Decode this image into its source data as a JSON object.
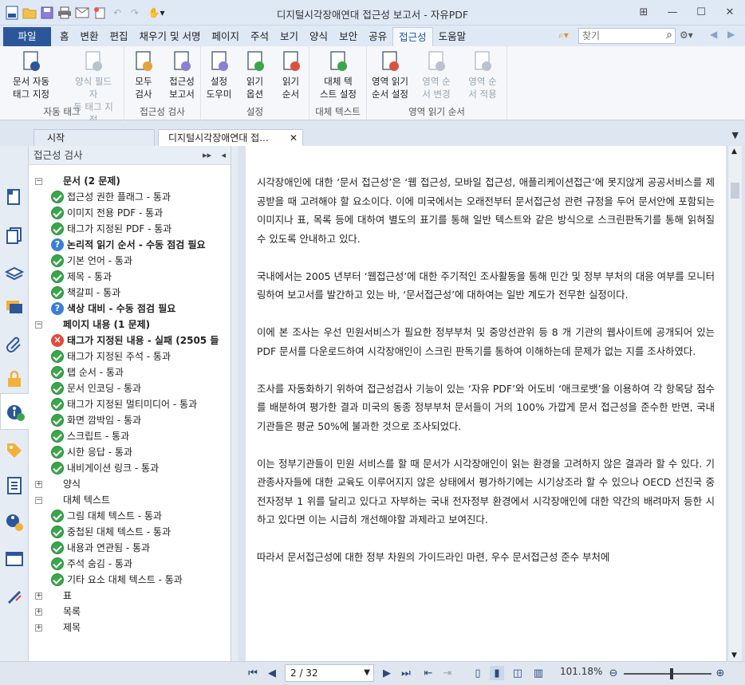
{
  "app": {
    "title": "디지털시각장애연대 접근성 보고서 - 자유PDF"
  },
  "ribbon_tabs": {
    "file": "파일",
    "items": [
      "홈",
      "변환",
      "편집",
      "채우기 및 서명",
      "페이지",
      "주석",
      "보기",
      "양식",
      "보안",
      "공유",
      "접근성",
      "도움말"
    ],
    "active_index": 10
  },
  "search": {
    "placeholder": "찾기"
  },
  "ribbon": {
    "groups": [
      {
        "label": "자동 태그",
        "buttons": [
          {
            "l1": "문서 자동",
            "l2": "태그 지정",
            "disabled": false
          },
          {
            "l1": "양식 필드 자",
            "l2": "동 태그 지정",
            "disabled": true
          }
        ]
      },
      {
        "label": "접근성 검사",
        "buttons": [
          {
            "l1": "모두",
            "l2": "검사",
            "disabled": false
          },
          {
            "l1": "접근성",
            "l2": "보고서",
            "disabled": false
          }
        ]
      },
      {
        "label": "설정",
        "buttons": [
          {
            "l1": "설정",
            "l2": "도우미",
            "disabled": false
          },
          {
            "l1": "읽기",
            "l2": "옵션",
            "disabled": false
          },
          {
            "l1": "읽기",
            "l2": "순서",
            "disabled": false
          }
        ]
      },
      {
        "label": "대체 텍스트",
        "buttons": [
          {
            "l1": "대체 텍",
            "l2": "스트 설정",
            "disabled": false
          }
        ]
      },
      {
        "label": "영역 읽기 순서",
        "buttons": [
          {
            "l1": "영역 읽기",
            "l2": "순서 설정",
            "disabled": false
          },
          {
            "l1": "영역 순",
            "l2": "서 변경",
            "disabled": true
          },
          {
            "l1": "영역 순",
            "l2": "서 적용",
            "disabled": true
          }
        ]
      }
    ]
  },
  "doc_tabs": {
    "start": "시작",
    "document": "디지털시각장애연대 접..."
  },
  "panel": {
    "title": "접근성 검사"
  },
  "tree": [
    {
      "level": 0,
      "exp": "-",
      "status": "",
      "text": "문서 (2 문제)",
      "bold": true
    },
    {
      "level": 1,
      "exp": "",
      "status": "pass",
      "text": "접근성 권한 플래그 - 통과",
      "bold": false
    },
    {
      "level": 1,
      "exp": "",
      "status": "pass",
      "text": "이미지 전용 PDF - 통과",
      "bold": false
    },
    {
      "level": 1,
      "exp": "",
      "status": "pass",
      "text": "태그가 지정된 PDF - 통과",
      "bold": false
    },
    {
      "level": 1,
      "exp": "",
      "status": "q",
      "text": "논리적 읽기 순서 - 수동 점검 필요",
      "bold": true
    },
    {
      "level": 1,
      "exp": "",
      "status": "pass",
      "text": "기본 언어 - 통과",
      "bold": false
    },
    {
      "level": 1,
      "exp": "",
      "status": "pass",
      "text": "제목 - 통과",
      "bold": false
    },
    {
      "level": 1,
      "exp": "",
      "status": "pass",
      "text": "책갈피 - 통과",
      "bold": false
    },
    {
      "level": 1,
      "exp": "",
      "status": "q",
      "text": "색상 대비 - 수동 점검 필요",
      "bold": true
    },
    {
      "level": 0,
      "exp": "-",
      "status": "",
      "text": "페이지 내용 (1 문제)",
      "bold": true
    },
    {
      "level": 1,
      "exp": "",
      "status": "fail",
      "text": "태그가 지정된 내용 - 실패 (2505 들",
      "bold": true
    },
    {
      "level": 1,
      "exp": "",
      "status": "pass",
      "text": "태그가 지정된 주석 - 통과",
      "bold": false
    },
    {
      "level": 1,
      "exp": "",
      "status": "pass",
      "text": "탭 순서 - 통과",
      "bold": false
    },
    {
      "level": 1,
      "exp": "",
      "status": "pass",
      "text": "문서 인코딩 - 통과",
      "bold": false
    },
    {
      "level": 1,
      "exp": "",
      "status": "pass",
      "text": "태그가 지정된 멀티미디어 - 통과",
      "bold": false
    },
    {
      "level": 1,
      "exp": "",
      "status": "pass",
      "text": "화면 깜박임 - 통과",
      "bold": false
    },
    {
      "level": 1,
      "exp": "",
      "status": "pass",
      "text": "스크립트 - 통과",
      "bold": false
    },
    {
      "level": 1,
      "exp": "",
      "status": "pass",
      "text": "시한 응답 - 통과",
      "bold": false
    },
    {
      "level": 1,
      "exp": "",
      "status": "pass",
      "text": "내비게이션 링크 - 통과",
      "bold": false
    },
    {
      "level": 0,
      "exp": "+",
      "status": "",
      "text": "양식",
      "bold": false
    },
    {
      "level": 0,
      "exp": "-",
      "status": "",
      "text": "대체 텍스트",
      "bold": false
    },
    {
      "level": 1,
      "exp": "",
      "status": "pass",
      "text": "그림 대체 텍스트 - 통과",
      "bold": false
    },
    {
      "level": 1,
      "exp": "",
      "status": "pass",
      "text": "중첩된 대체 텍스트 - 통과",
      "bold": false
    },
    {
      "level": 1,
      "exp": "",
      "status": "pass",
      "text": "내용과 연관됨 - 통과",
      "bold": false
    },
    {
      "level": 1,
      "exp": "",
      "status": "pass",
      "text": "주석 숨김 - 통과",
      "bold": false
    },
    {
      "level": 1,
      "exp": "",
      "status": "pass",
      "text": "기타 요소 대체 텍스트 - 통과",
      "bold": false
    },
    {
      "level": 0,
      "exp": "+",
      "status": "",
      "text": "표",
      "bold": false
    },
    {
      "level": 0,
      "exp": "+",
      "status": "",
      "text": "목록",
      "bold": false
    },
    {
      "level": 0,
      "exp": "+",
      "status": "",
      "text": "제목",
      "bold": false
    }
  ],
  "document": {
    "paragraphs": [
      "시각장애인에 대한 ‘문서 접근성’은 ‘웹 접근성, 모바일 접근성, 애플리케이션접근’에 못지않게 공공서비스를 제공받을 때 고려해야 할 요소이다. 이에 미국에서는 오래전부터 문서접근성 관련 규정을 두어 문서안에 포함되는 이미지나 표, 목록 등에 대하여 별도의 표기를 통해 일반 텍스트와 같은 방식으로 스크린판독기를 통해 읽혀질 수 있도록 안내하고 있다.",
      "국내에서는 2005 년부터 ‘웹접근성’에 대한 주기적인 조사활동을 통해 민간 및 정부 부처의 대응 여부를 모니터링하여 보고서를 발간하고 있는 바, ‘문서접근성’에 대하여는 일반 계도가 전무한 실정이다.",
      "이에 본 조사는 우선 민원서비스가 필요한 정부부처 및 중앙선관위 등 8 개 기관의 웹사이트에 공개되어 있는 PDF 문서를 다운로드하여 시각장애인이 스크린 판독기를 통하여 이해하는데 문제가 없는 지를 조사하였다.",
      "조사를 자동화하기 위하여 접근성검사 기능이 있는 ‘자유 PDF’와 어도비 ‘애크로뱃’을 이용하여 각 항목당 점수를 배분하여 평가한 결과 미국의 동종 정부부처 문서들이 거의 100% 가깝게 문서 접근성을 준수한 반면, 국내 기관들은 평균 50%에 불과한 것으로 조사되었다.",
      "이는 정부기관들이 민원 서비스를 할 때 문서가 시각장애인이 읽는 환경을 고려하지 않은 결과라 할 수 있다. 기관종사자들에 대한 교육도 이루어지지 않은 상태에서 평가하기에는 시기상조라 할 수 있으나 OECD 선진국 중 전자정부 1 위를 달리고 있다고 자부하는 국내 전자정부 환경에서 시각장애인에 대한 약간의 배려마저 등한 시 하고 있다면 이는 시급히 개선해야할 과제라고 보여진다.",
      "따라서 문서접근성에 대한 정부 차원의 가이드라인 마련, 우수 문서접근성 준수 부처에"
    ]
  },
  "status": {
    "page": "2 / 32",
    "zoom": "101.18%"
  }
}
